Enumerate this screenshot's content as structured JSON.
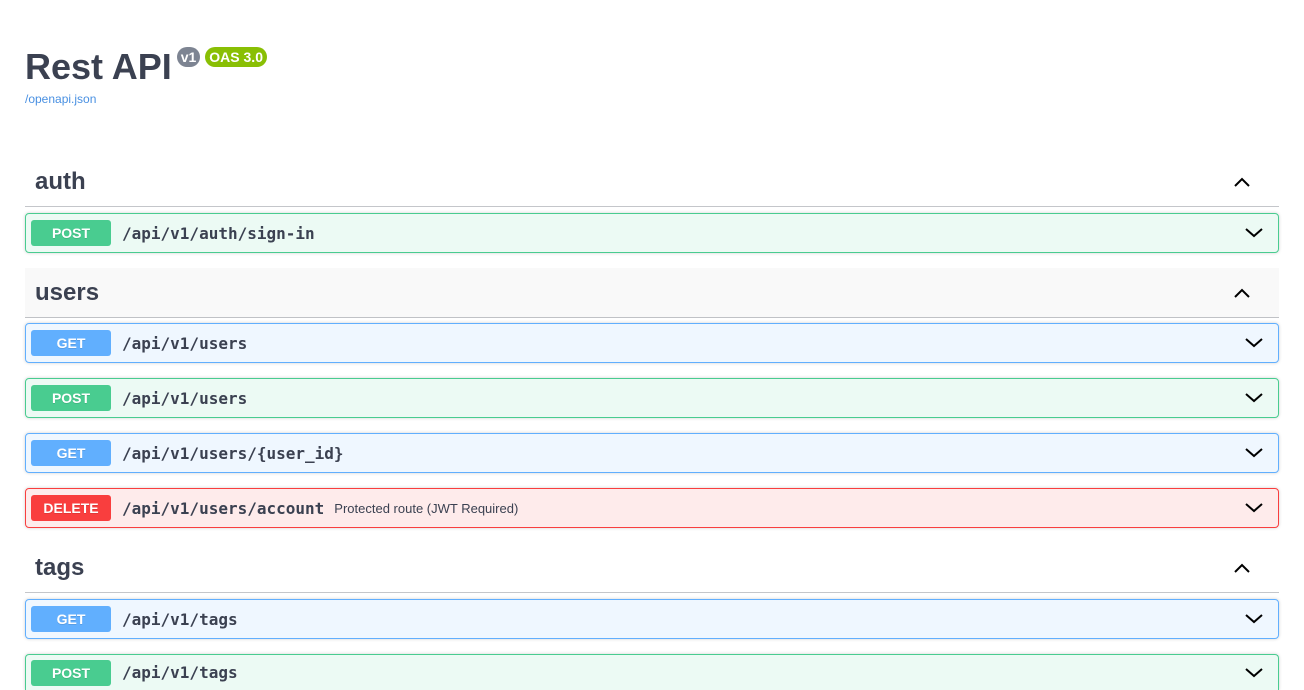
{
  "info": {
    "title": "Rest API",
    "version_badge": "v1",
    "oas_badge": "OAS 3.0",
    "spec_link": "/openapi.json"
  },
  "tags": [
    {
      "name": "auth",
      "operations": [
        {
          "method": "POST",
          "path": "/api/v1/auth/sign-in",
          "summary": ""
        }
      ]
    },
    {
      "name": "users",
      "operations": [
        {
          "method": "GET",
          "path": "/api/v1/users",
          "summary": ""
        },
        {
          "method": "POST",
          "path": "/api/v1/users",
          "summary": ""
        },
        {
          "method": "GET",
          "path": "/api/v1/users/{user_id}",
          "summary": ""
        },
        {
          "method": "DELETE",
          "path": "/api/v1/users/account",
          "summary": "Protected route (JWT Required)"
        }
      ]
    },
    {
      "name": "tags",
      "operations": [
        {
          "method": "GET",
          "path": "/api/v1/tags",
          "summary": ""
        },
        {
          "method": "POST",
          "path": "/api/v1/tags",
          "summary": ""
        }
      ]
    }
  ],
  "colors": {
    "post": "#49cc90",
    "get": "#61affe",
    "delete": "#f93e3e",
    "text": "#3b4151",
    "version_badge": "#7d8492",
    "oas_badge": "#89bf04",
    "link": "#4990e2"
  },
  "icons": {
    "tag_expanded": "chevron-up-icon",
    "op_collapsed": "chevron-down-icon"
  }
}
